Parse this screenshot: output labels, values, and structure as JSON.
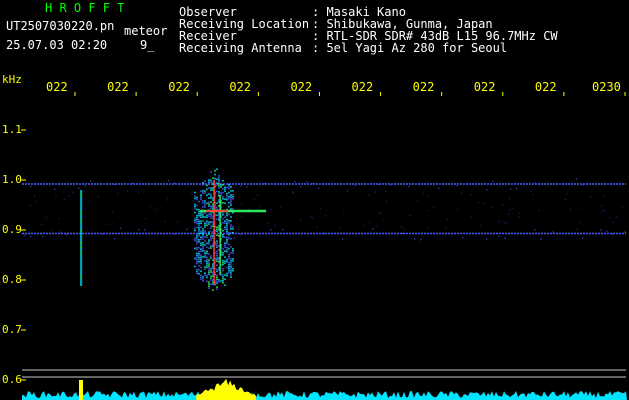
{
  "header": {
    "title": "H R O F F T",
    "filename": "UT2507030220.pn",
    "meteor_label": "meteor",
    "date_time": "25.07.03 02:20",
    "count": "9_"
  },
  "info": [
    {
      "label": "Observer",
      "value": ": Masaki Kano"
    },
    {
      "label": "Receiving Location",
      "value": ": Shibukawa, Gunma, Japan"
    },
    {
      "label": "Receiver",
      "value": ": RTL-SDR SDR# 43dB L15 96.7MHz CW"
    },
    {
      "label": "Receiving Antenna",
      "value": ": 5el Yagi Az 280 for Seoul"
    }
  ],
  "chart_data": {
    "type": "heatmap",
    "ylabel": "kHz",
    "x_tick_labels": [
      "022",
      "022",
      "022",
      "022",
      "022",
      "022",
      "022",
      "022",
      "022",
      "0230"
    ],
    "y_tick_labels": [
      "1.1",
      "1.0",
      "0.9",
      "0.8",
      "0.7",
      "0.6"
    ],
    "y_tick_values": [
      1.1,
      1.0,
      0.9,
      0.8,
      0.7,
      0.6
    ],
    "ylim": [
      0.58,
      1.2
    ],
    "carrier_lines_khz": [
      0.992,
      0.893
    ],
    "meteor_events": [
      {
        "time_fraction": 0.0,
        "freq_low_khz": 0.79,
        "freq_high_khz": 0.98,
        "intensity": 0.5
      },
      {
        "time_fraction": 0.213,
        "freq_low_khz": 0.77,
        "freq_high_khz": 1.03,
        "intensity": 1.0,
        "head_echo_khz": 0.938
      }
    ],
    "colors": {
      "background": "#000000",
      "tick_text": "#ffff00",
      "header_text": "#ffffff",
      "title_text": "#00ff00",
      "carrier": "#4a5cff",
      "echo_core": "#ff3b3b",
      "echo_mid": "#33ff66",
      "noise": "#00e5ff",
      "noise_peak": "#ffff00",
      "separator": "#c8c8c8"
    }
  }
}
